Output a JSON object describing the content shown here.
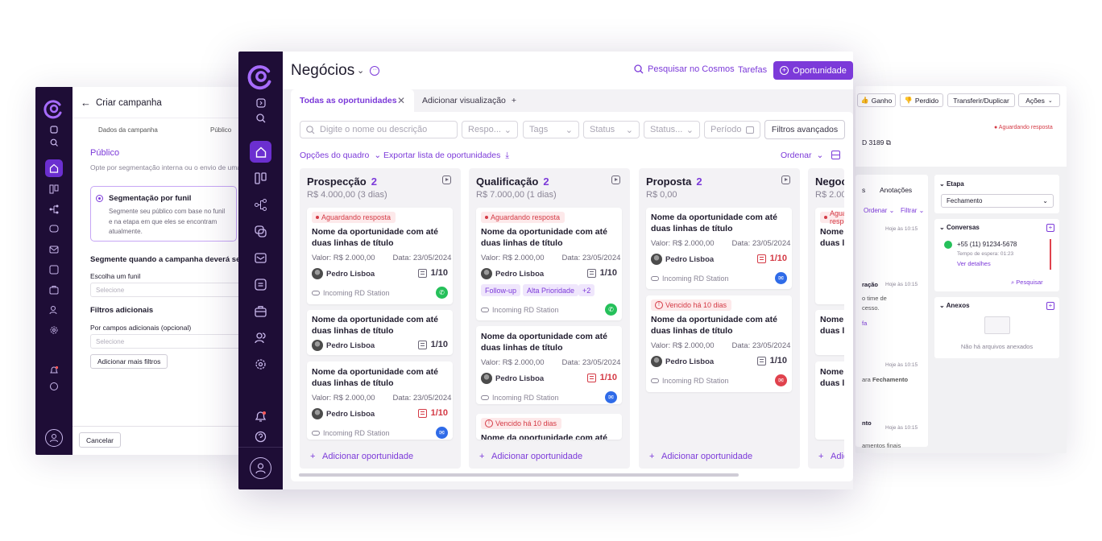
{
  "left_window": {
    "title": "Criar campanha",
    "steps": [
      "Dados da campanha",
      "Público"
    ],
    "section_title": "Público",
    "section_desc": "Opte por segmentação interna ou o envio de uma",
    "option_title": "Segmentação por funil",
    "option_desc": "Segmente seu público com base no funil e na etapa em que eles se encontram atualmente.",
    "question": "Segmente quando a campanha deverá ser",
    "funnel_label": "Escolha um funil",
    "funnel_placeholder": "Selecione",
    "extra_title": "Filtros adicionais",
    "extra_label": "Por campos adicionais (opcional)",
    "extra_placeholder": "Selecione",
    "add_filters": "Adicionar mais filtros",
    "cancel": "Cancelar"
  },
  "header": {
    "title": "Negócios",
    "search_link": "Pesquisar no Cosmos",
    "tasks_link": "Tarefas",
    "new_button": "Oportunidade"
  },
  "tabs": {
    "active": "Todas as oportunidades",
    "add": "Adicionar visualização"
  },
  "filters": {
    "search_placeholder": "Digite o nome ou descrição",
    "resp": "Respo...",
    "tags": "Tags",
    "status": "Status",
    "status2": "Status...",
    "period": "Período",
    "advanced": "Filtros avançados"
  },
  "board_actions": {
    "options": "Opções do quadro",
    "export": "Exportar lista de oportunidades",
    "sort": "Ordenar"
  },
  "columns": [
    {
      "name": "Prospecção",
      "count": "2",
      "sum": "R$ 4.000,00 (3 dias)"
    },
    {
      "name": "Qualificação",
      "count": "2",
      "sum": "R$ 7.000,00 (1 dias)"
    },
    {
      "name": "Proposta",
      "count": "2",
      "sum": "R$ 0,00"
    },
    {
      "name": "Negoci",
      "sum": "R$ 2.00"
    }
  ],
  "card": {
    "title": "Nome da oportunidade com até duas linhas de título",
    "value": "Valor: R$ 2.000,00",
    "date": "Data: 23/05/2024",
    "owner": "Pedro Lisboa",
    "tasks": "1/10",
    "source": "Incoming RD Station",
    "wait": "Aguardando resposta",
    "late": "Vencido há 10 dias",
    "title_partial": "Nome da oportunidade com até duas",
    "tag1": "Follow-up",
    "tag2": "Alta Prioridade",
    "tag3": "+2"
  },
  "add_opportunity": "Adicionar oportunidade",
  "right_window": {
    "won": "Ganho",
    "lost": "Perdido",
    "transfer": "Transferir/Duplicar",
    "actions": "Ações",
    "status": "Aguardando resposta",
    "id": "D 3189",
    "tab": "Anotações",
    "tab_prefix": "s",
    "sort": "Ordenar",
    "filter": "Filtrar",
    "time": "Hoje às 10:15",
    "stage_title": "Etapa",
    "stage_value": "Fechamento",
    "conv_title": "Conversas",
    "phone": "+55 (11) 91234-5678",
    "wait_time": "Tempo de espera: 01:23",
    "details": "Ver detalhes",
    "search": "Pesquisar",
    "attach_title": "Anexos",
    "no_files": "Não há arquivos anexados",
    "frag1": "ração",
    "frag2": "o time de",
    "frag3": "cesso.",
    "frag4": "fa",
    "frag5": "ara",
    "frag6": "Fechamento",
    "frag7": "nto",
    "frag8": "amentos finais"
  }
}
